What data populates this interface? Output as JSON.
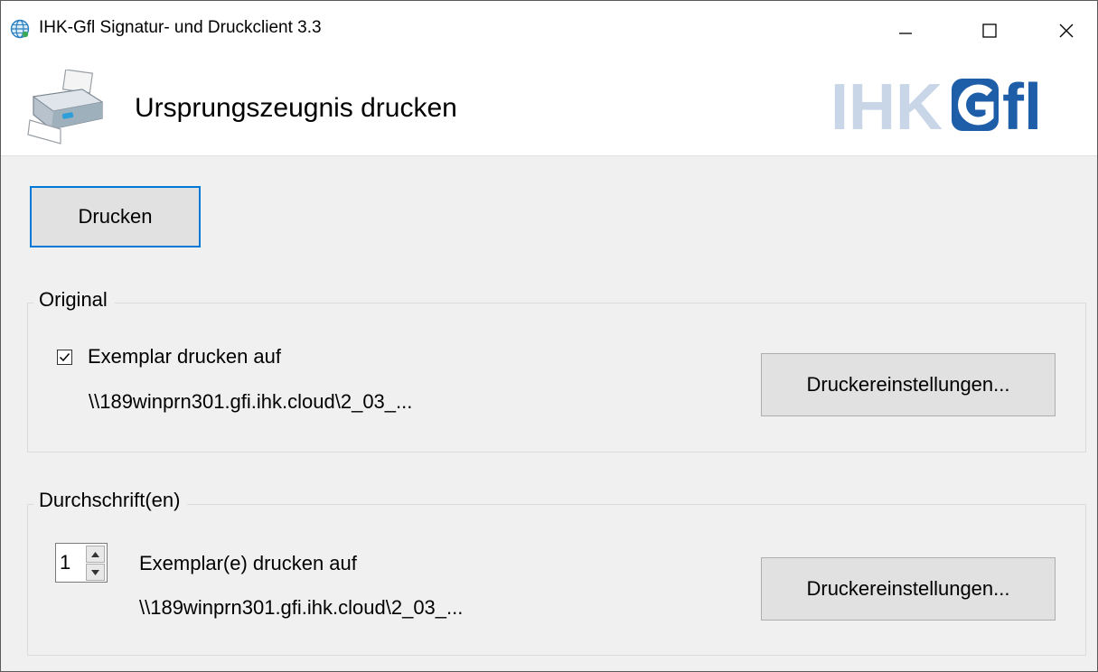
{
  "window": {
    "title": "IHK-Gfl Signatur- und Druckclient 3.3",
    "controls": [
      "minimize-icon",
      "maximize-icon",
      "close-icon"
    ]
  },
  "header": {
    "title": "Ursprungszeugnis drucken",
    "logo_text": "IHKGfl",
    "icon": "printer-icon"
  },
  "actions": {
    "print_label": "Drucken"
  },
  "original": {
    "legend": "Original",
    "checkbox_checked": true,
    "checkbox_label": "Exemplar drucken auf",
    "printer_path": "\\\\189winprn301.gfi.ihk.cloud\\2_03_...",
    "settings_label": "Druckereinstellungen..."
  },
  "durchschrift": {
    "legend": "Durchschrift(en)",
    "copies": "1",
    "copies_label": "Exemplar(e) drucken auf",
    "printer_path": "\\\\189winprn301.gfi.ihk.cloud\\2_03_...",
    "settings_label": "Druckereinstellungen..."
  },
  "colors": {
    "accent": "#0078d7",
    "logo_light": "#c8d6e8",
    "logo_dark": "#1e5ea8"
  }
}
